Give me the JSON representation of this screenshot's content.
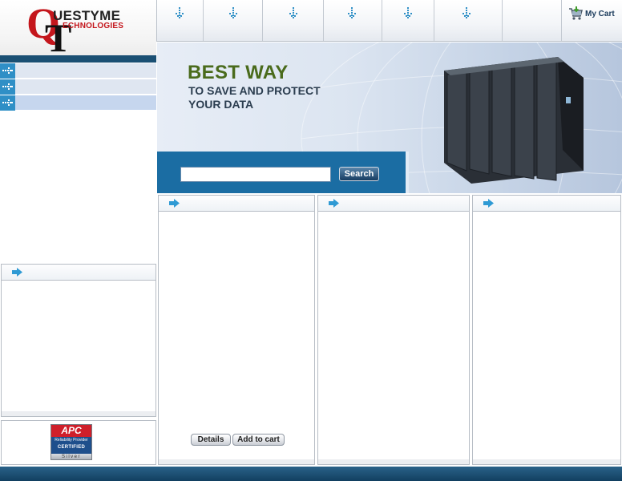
{
  "logo": {
    "letter_q": "Q",
    "letter_t": "T",
    "line1": "UESTYME",
    "line2": "ECHNOLOGIES"
  },
  "nav": {
    "items": [
      {
        "icon": "down-arrow-icon"
      },
      {
        "icon": "down-arrow-icon"
      },
      {
        "icon": "down-arrow-icon"
      },
      {
        "icon": "down-arrow-icon"
      },
      {
        "icon": "down-arrow-icon"
      },
      {
        "icon": "down-arrow-icon"
      }
    ],
    "cart_label": "My Cart",
    "cart_icon": "shopping-cart-icon"
  },
  "sidebar": {
    "items": [
      {
        "icon": "arrow-right-icon"
      },
      {
        "icon": "arrow-right-icon"
      },
      {
        "icon": "arrow-right-icon"
      }
    ]
  },
  "banner": {
    "headline": "BEST WAY",
    "line2": "TO SAVE AND PROTECT",
    "line3": "YOUR DATA",
    "search_placeholder": "",
    "search_button": "Search"
  },
  "product": {
    "details_button": "Details",
    "add_to_cart_button": "Add to cart"
  },
  "badge": {
    "brand": "APC",
    "line1": "Reliability Provider",
    "line2": "CERTIFIED",
    "line3": "Silver"
  },
  "colors": {
    "brand_red": "#c4161c",
    "brand_blue": "#1b6da3",
    "dark_blue": "#1a4f73",
    "headline_green": "#4a6b1c"
  }
}
